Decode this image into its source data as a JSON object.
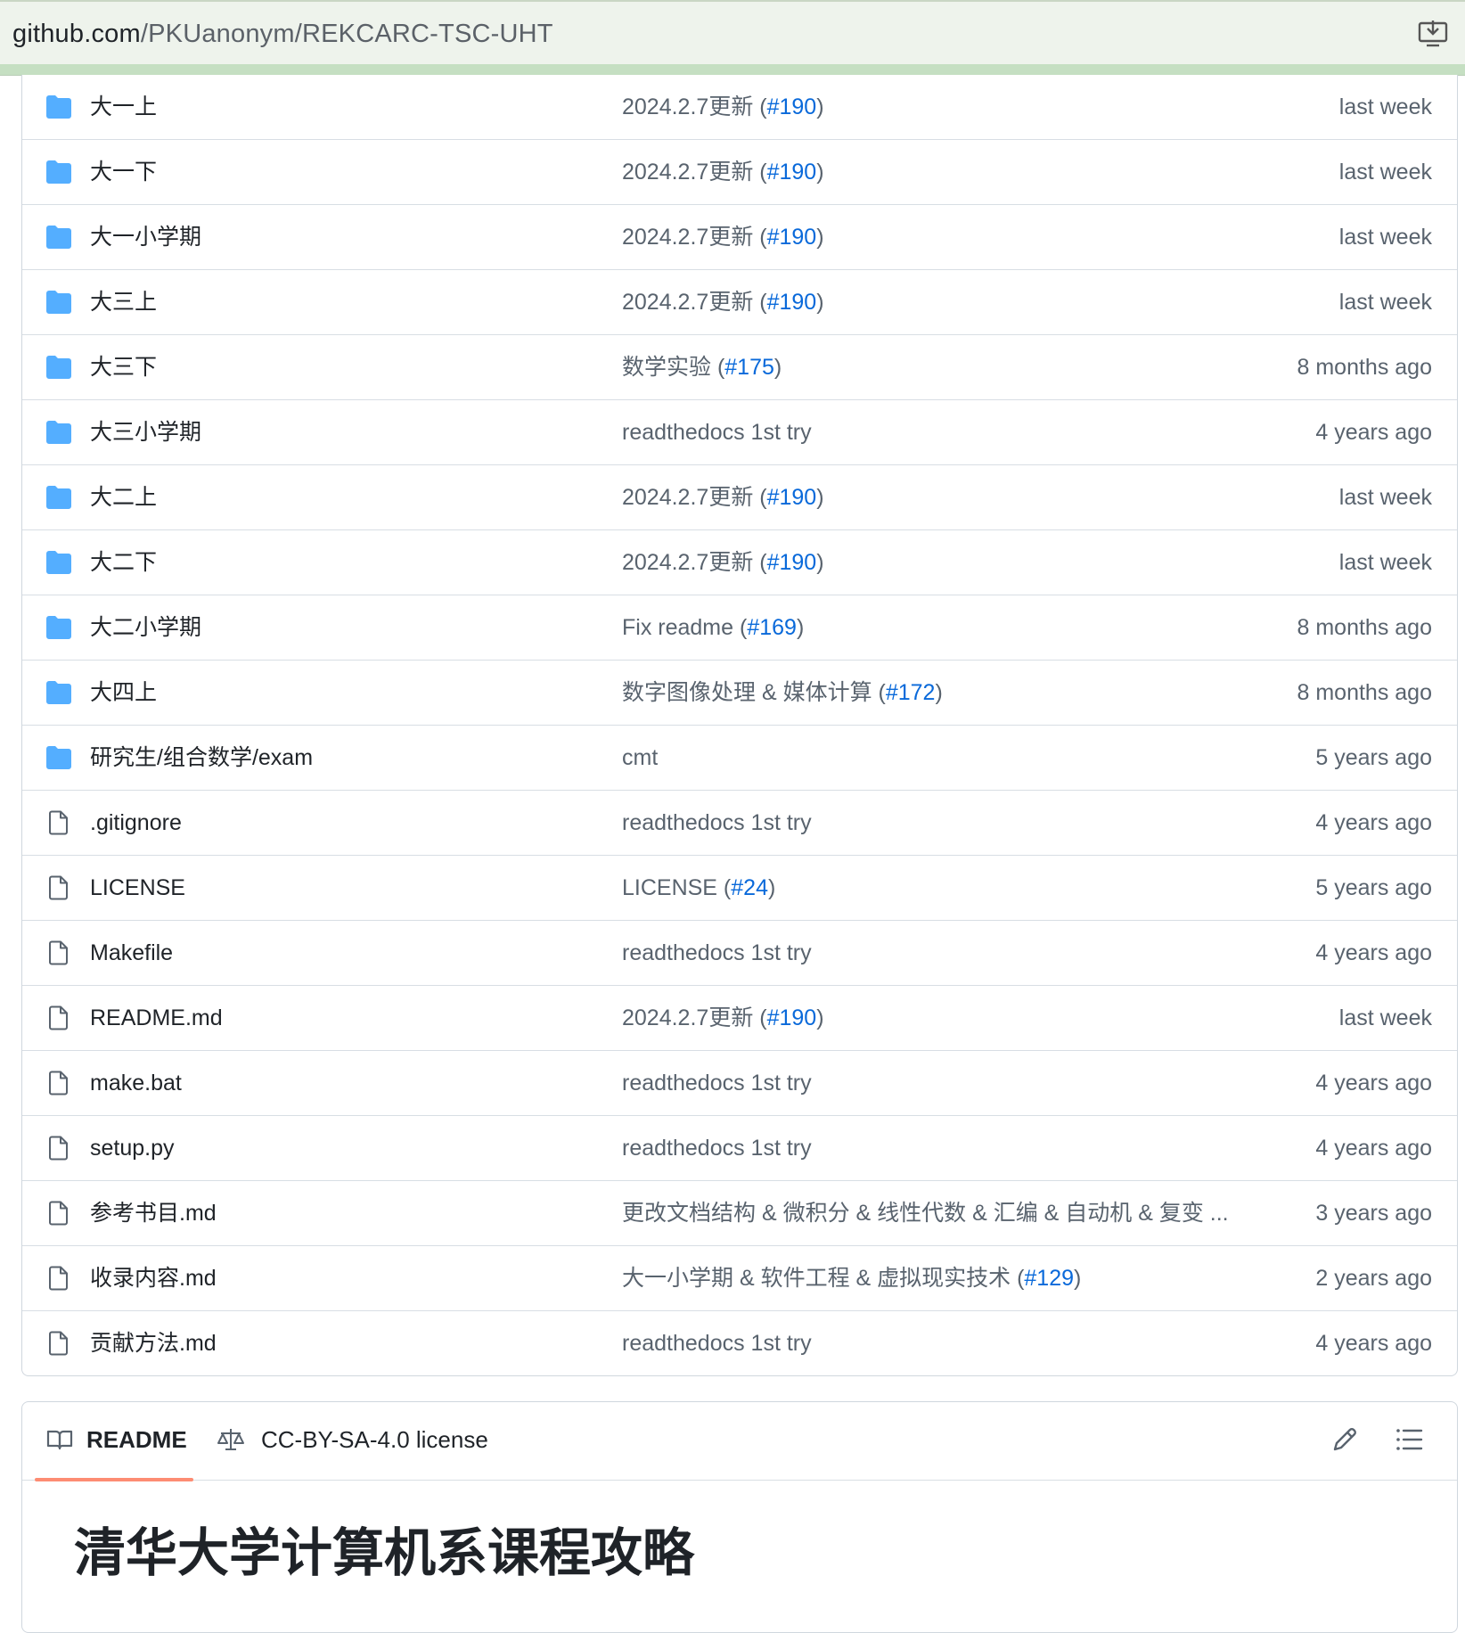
{
  "browser": {
    "url_host": "github.com",
    "url_path": "/PKUanonym/REKCARC-TSC-UHT"
  },
  "files": [
    {
      "type": "folder",
      "name": "大一上",
      "message": "2024.2.7更新 (",
      "pr": "#190",
      "tail": ")",
      "time": "last week"
    },
    {
      "type": "folder",
      "name": "大一下",
      "message": "2024.2.7更新 (",
      "pr": "#190",
      "tail": ")",
      "time": "last week"
    },
    {
      "type": "folder",
      "name": "大一小学期",
      "message": "2024.2.7更新 (",
      "pr": "#190",
      "tail": ")",
      "time": "last week"
    },
    {
      "type": "folder",
      "name": "大三上",
      "message": "2024.2.7更新 (",
      "pr": "#190",
      "tail": ")",
      "time": "last week"
    },
    {
      "type": "folder",
      "name": "大三下",
      "message": "数学实验 (",
      "pr": "#175",
      "tail": ")",
      "time": "8 months ago"
    },
    {
      "type": "folder",
      "name": "大三小学期",
      "message": "readthedocs 1st try",
      "pr": "",
      "tail": "",
      "time": "4 years ago"
    },
    {
      "type": "folder",
      "name": "大二上",
      "message": "2024.2.7更新 (",
      "pr": "#190",
      "tail": ")",
      "time": "last week"
    },
    {
      "type": "folder",
      "name": "大二下",
      "message": "2024.2.7更新 (",
      "pr": "#190",
      "tail": ")",
      "time": "last week"
    },
    {
      "type": "folder",
      "name": "大二小学期",
      "message": "Fix readme (",
      "pr": "#169",
      "tail": ")",
      "time": "8 months ago"
    },
    {
      "type": "folder",
      "name": "大四上",
      "message": "数字图像处理 & 媒体计算 (",
      "pr": "#172",
      "tail": ")",
      "time": "8 months ago"
    },
    {
      "type": "folder",
      "name": "研究生/组合数学/exam",
      "message": "cmt",
      "pr": "",
      "tail": "",
      "time": "5 years ago"
    },
    {
      "type": "file",
      "name": ".gitignore",
      "message": "readthedocs 1st try",
      "pr": "",
      "tail": "",
      "time": "4 years ago"
    },
    {
      "type": "file",
      "name": "LICENSE",
      "message": "LICENSE (",
      "pr": "#24",
      "tail": ")",
      "time": "5 years ago"
    },
    {
      "type": "file",
      "name": "Makefile",
      "message": "readthedocs 1st try",
      "pr": "",
      "tail": "",
      "time": "4 years ago"
    },
    {
      "type": "file",
      "name": "README.md",
      "message": "2024.2.7更新 (",
      "pr": "#190",
      "tail": ")",
      "time": "last week"
    },
    {
      "type": "file",
      "name": "make.bat",
      "message": "readthedocs 1st try",
      "pr": "",
      "tail": "",
      "time": "4 years ago"
    },
    {
      "type": "file",
      "name": "setup.py",
      "message": "readthedocs 1st try",
      "pr": "",
      "tail": "",
      "time": "4 years ago"
    },
    {
      "type": "file",
      "name": "参考书目.md",
      "message": "更改文档结构 & 微积分 & 线性代数 & 汇编 & 自动机 & 复变 ...",
      "pr": "",
      "tail": "",
      "time": "3 years ago"
    },
    {
      "type": "file",
      "name": "收录内容.md",
      "message": "大一小学期 & 软件工程 & 虚拟现实技术 (",
      "pr": "#129",
      "tail": ")",
      "time": "2 years ago"
    },
    {
      "type": "file",
      "name": "贡献方法.md",
      "message": "readthedocs 1st try",
      "pr": "",
      "tail": "",
      "time": "4 years ago"
    }
  ],
  "readme": {
    "tab_readme": "README",
    "tab_license": "CC-BY-SA-4.0 license",
    "heading": "清华大学计算机系课程攻略"
  },
  "colors": {
    "folder": "#54aeff",
    "link": "#0969da",
    "tab_underline": "#fd8c73"
  }
}
